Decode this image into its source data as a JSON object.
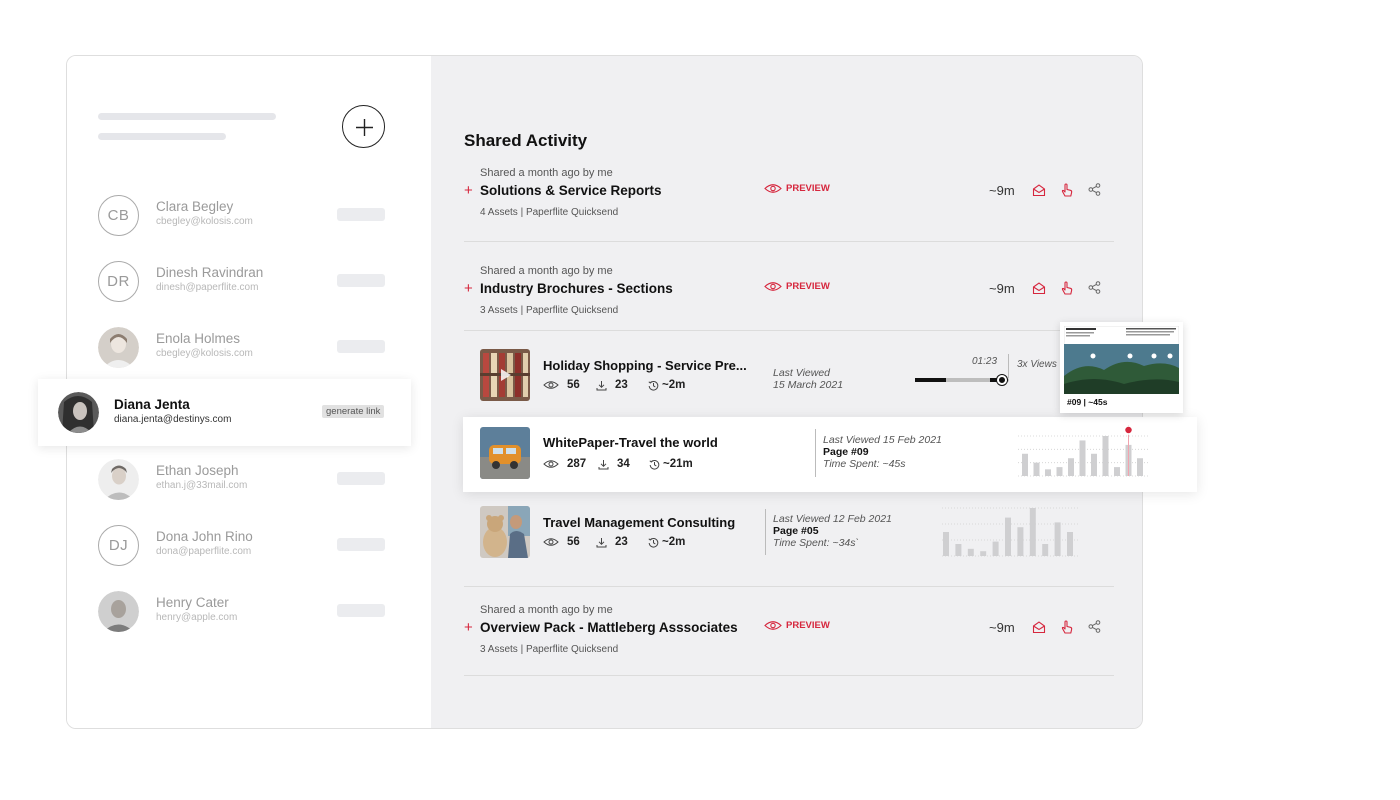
{
  "contacts": [
    {
      "initials": "CB",
      "name": "Clara Begley",
      "email": "cbegley@kolosis.com",
      "photo": false
    },
    {
      "initials": "DR",
      "name": "Dinesh Ravindran",
      "email": "dinesh@paperflite.com",
      "photo": false
    },
    {
      "initials": "",
      "name": "Enola Holmes",
      "email": "cbegley@kolosis.com",
      "photo": true
    },
    {
      "initials": "",
      "name": "Ethan Joseph",
      "email": "ethan.j@33mail.com",
      "photo": true
    },
    {
      "initials": "DJ",
      "name": "Dona John Rino",
      "email": "dona@paperflite.com",
      "photo": false
    },
    {
      "initials": "",
      "name": "Henry Cater",
      "email": "henry@apple.com",
      "photo": true
    }
  ],
  "selected_contact": {
    "name": "Diana Jenta",
    "email": "diana.jenta@destinys.com",
    "action": "generate link"
  },
  "main": {
    "title": "Shared Activity",
    "shares": [
      {
        "meta": "Shared a month ago by me",
        "title": "Solutions & Service Reports",
        "assets": "4 Assets  |  Paperflite Quicksend",
        "preview": "PREVIEW",
        "time": "~9m"
      },
      {
        "meta": "Shared a month ago by me",
        "title": "Industry Brochures - Sections",
        "assets": "3 Assets  |  Paperflite Quicksend",
        "preview": "PREVIEW",
        "time": "~9m"
      },
      {
        "meta": "Shared a month ago by me",
        "title": "Overview Pack - Mattleberg Asssociates",
        "assets": "3 Assets  |  Paperflite Quicksend",
        "preview": "PREVIEW",
        "time": "~9m"
      }
    ],
    "assets": [
      {
        "title": "Holiday Shopping - Service Pre...",
        "views": "56",
        "downloads": "23",
        "time": "~2m",
        "last_viewed_label": "Last Viewed",
        "last_viewed_date": "15 March 2021",
        "video_time": "01:23",
        "video_progress": 0.93,
        "views_label": "3x Views"
      },
      {
        "title": "WhitePaper-Travel the world",
        "views": "287",
        "downloads": "34",
        "time": "~21m",
        "last_viewed": "Last Viewed 15 Feb 2021",
        "page": "Page #09",
        "time_spent": "Time Spent: ~45s",
        "bars": [
          5,
          3,
          1.5,
          2,
          4,
          8,
          5,
          9,
          2,
          7,
          4
        ],
        "popup_label": "#09 | ~45s"
      },
      {
        "title": "Travel Management Consulting",
        "views": "56",
        "downloads": "23",
        "time": "~2m",
        "last_viewed": "Last Viewed 12 Feb 2021",
        "page": "Page #05",
        "time_spent": "Time Spent: ~34s`",
        "bars": [
          5,
          2.5,
          1.5,
          1,
          3,
          8,
          6,
          10,
          2.5,
          7,
          5
        ]
      }
    ]
  },
  "colors": {
    "accent": "#d6273e",
    "panel": "#f0f0f2"
  }
}
